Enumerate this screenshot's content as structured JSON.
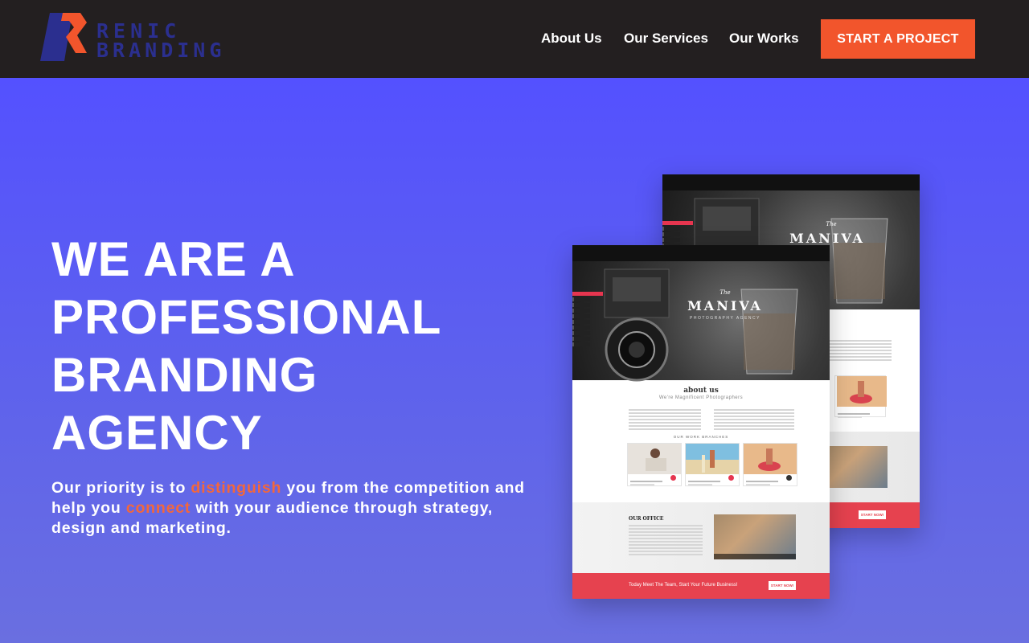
{
  "brand": {
    "logo_line1": "RENIC",
    "logo_line2": "BRANDING",
    "colors": {
      "dark": "#231f20",
      "navy": "#2b2f8f",
      "accent": "#f2552c",
      "hero": "#5451ff"
    }
  },
  "nav": {
    "items": [
      "About Us",
      "Our Services",
      "Our Works"
    ],
    "cta": "START A PROJECT"
  },
  "hero": {
    "headline_lines": [
      "WE ARE A",
      "PROFESSIONAL",
      "BRANDING",
      "AGENCY"
    ],
    "tagline": {
      "part1": "Our priority is to ",
      "highlight1": "distinguish",
      "part2": " you from the competition and help you ",
      "highlight2": "connect",
      "part3": " with your audience through strategy, design and marketing."
    }
  },
  "mockup": {
    "brand_small": "The",
    "brand": "MANIVA",
    "brand_sub": "PHOTOGRAPHY AGENCY",
    "about_title": "about us",
    "about_sub": "We're Magnificent Photographers",
    "branches_title": "OUR WORK BRANCHES",
    "office_title": "OUR OFFICE",
    "footer_text": "Today Meet The Team, Start Your Future Business!",
    "footer_button": "START NOW!"
  }
}
